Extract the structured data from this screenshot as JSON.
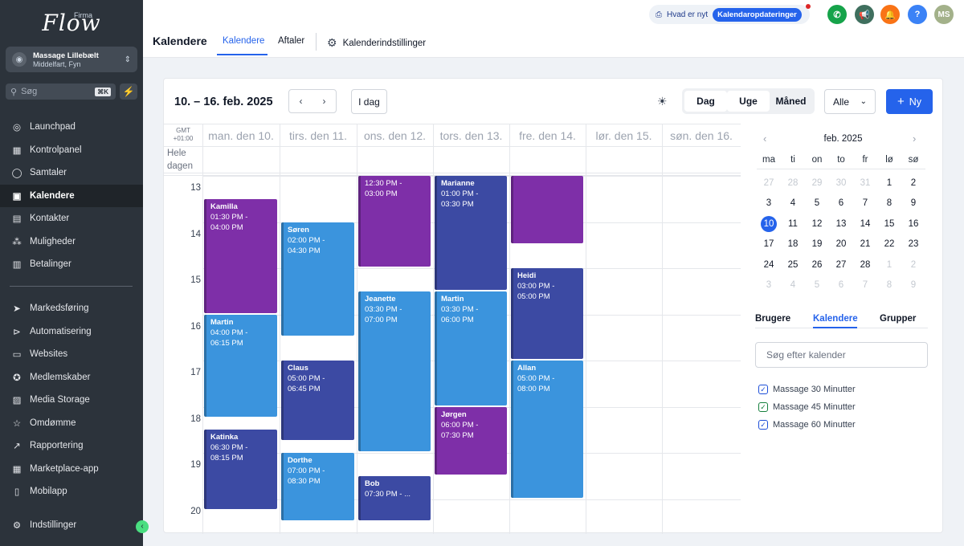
{
  "sidebar": {
    "logo_text": "Flow",
    "logo_super": "Firma",
    "account": {
      "name": "Massage Lillebælt",
      "location": "Middelfart, Fyn"
    },
    "search": {
      "placeholder": "Søg",
      "shortcut": "⌘K"
    },
    "items": [
      {
        "label": "Launchpad",
        "icon": "launchpad-icon"
      },
      {
        "label": "Kontrolpanel",
        "icon": "dashboard-icon"
      },
      {
        "label": "Samtaler",
        "icon": "chat-icon"
      },
      {
        "label": "Kalendere",
        "icon": "calendar-icon",
        "active": true
      },
      {
        "label": "Kontakter",
        "icon": "contacts-icon"
      },
      {
        "label": "Muligheder",
        "icon": "opportunities-icon"
      },
      {
        "label": "Betalinger",
        "icon": "payments-icon"
      }
    ],
    "items2": [
      {
        "label": "Markedsføring",
        "icon": "send-icon"
      },
      {
        "label": "Automatisering",
        "icon": "automation-icon"
      },
      {
        "label": "Websites",
        "icon": "websites-icon"
      },
      {
        "label": "Medlemskaber",
        "icon": "membership-icon"
      },
      {
        "label": "Media Storage",
        "icon": "image-icon"
      },
      {
        "label": "Omdømme",
        "icon": "star-icon"
      },
      {
        "label": "Rapportering",
        "icon": "chart-icon"
      },
      {
        "label": "Marketplace-app",
        "icon": "apps-icon"
      },
      {
        "label": "Mobilapp",
        "icon": "mobile-icon"
      }
    ],
    "settings": "Indstillinger"
  },
  "topbar": {
    "whats_new": "Hvad er nyt",
    "whats_new_tag": "Kalendaropdateringer",
    "avatar_initials": "MS",
    "help": "?",
    "page_title": "Kalendere",
    "tabs": [
      "Kalendere",
      "Aftaler"
    ],
    "settings_link": "Kalenderindstillinger"
  },
  "toolbar": {
    "range": "10. – 16. feb. 2025",
    "today": "I dag",
    "views": [
      "Dag",
      "Uge",
      "Måned"
    ],
    "filter": "Alle",
    "new": "Ny"
  },
  "week": {
    "gmt": [
      "GMT",
      "+01:00"
    ],
    "allday": [
      "Hele",
      "dagen"
    ],
    "days": [
      "man. den 10.",
      "tirs. den 11.",
      "ons. den 12.",
      "tors. den 13.",
      "fre. den 14.",
      "lør. den 15.",
      "søn. den 16."
    ],
    "hours": [
      "13",
      "14",
      "15",
      "16",
      "17",
      "18",
      "19",
      "20"
    ]
  },
  "events": [
    {
      "day": 0,
      "name": "Kamilla",
      "time": "01:30 PM -",
      "time2": "04:00 PM",
      "start": 13.5,
      "end": 16.0,
      "color": "#7e2fa8"
    },
    {
      "day": 0,
      "name": "Martin",
      "time": "04:00 PM -",
      "time2": "06:15 PM",
      "start": 16.0,
      "end": 18.25,
      "color": "#3b94dd"
    },
    {
      "day": 0,
      "name": "Katinka",
      "time": "06:30 PM -",
      "time2": "08:15 PM",
      "start": 18.5,
      "end": 20.25,
      "color": "#3c4aa3"
    },
    {
      "day": 1,
      "name": "Søren",
      "time": "02:00 PM -",
      "time2": "04:30 PM",
      "start": 14.0,
      "end": 16.5,
      "color": "#3b94dd"
    },
    {
      "day": 1,
      "name": "Claus",
      "time": "05:00 PM -",
      "time2": "06:45 PM",
      "start": 17.0,
      "end": 18.75,
      "color": "#3c4aa3"
    },
    {
      "day": 1,
      "name": "Dorthe",
      "time": "07:00 PM -",
      "time2": "08:30 PM",
      "start": 19.0,
      "end": 20.5,
      "color": "#3b94dd"
    },
    {
      "day": 2,
      "name": "",
      "time": "12:30 PM -",
      "time2": "03:00 PM",
      "start": 12.5,
      "end": 15.0,
      "color": "#7e2fa8"
    },
    {
      "day": 2,
      "name": "Jeanette",
      "time": "03:30 PM -",
      "time2": "07:00 PM",
      "start": 15.5,
      "end": 19.0,
      "color": "#3b94dd"
    },
    {
      "day": 2,
      "name": "Bob",
      "time": "07:30 PM - ...",
      "time2": "",
      "start": 19.5,
      "end": 20.5,
      "color": "#3c4aa3"
    },
    {
      "day": 3,
      "name": "Marianne",
      "time": "01:00 PM -",
      "time2": "03:30 PM",
      "start": 13.0,
      "end": 15.5,
      "color": "#3c4aa3"
    },
    {
      "day": 3,
      "name": "Martin",
      "time": "03:30 PM -",
      "time2": "06:00 PM",
      "start": 15.5,
      "end": 18.0,
      "color": "#3b94dd"
    },
    {
      "day": 3,
      "name": "Jørgen",
      "time": "06:00 PM -",
      "time2": "07:30 PM",
      "start": 18.0,
      "end": 19.5,
      "color": "#7e2fa8"
    },
    {
      "day": 4,
      "name": "",
      "time": "",
      "time2": "",
      "start": 12.5,
      "end": 14.5,
      "color": "#7e2fa8"
    },
    {
      "day": 4,
      "name": "Heidi",
      "time": "03:00 PM -",
      "time2": "05:00 PM",
      "start": 15.0,
      "end": 17.0,
      "color": "#3c4aa3"
    },
    {
      "day": 4,
      "name": "Allan",
      "time": "05:00 PM -",
      "time2": "08:00 PM",
      "start": 17.0,
      "end": 20.0,
      "color": "#3b94dd"
    }
  ],
  "mini_calendar": {
    "month": "feb. 2025",
    "weekdays": [
      "ma",
      "ti",
      "on",
      "to",
      "fr",
      "lø",
      "sø"
    ],
    "weeks": [
      [
        "27",
        "28",
        "29",
        "30",
        "31",
        "1",
        "2"
      ],
      [
        "3",
        "4",
        "5",
        "6",
        "7",
        "8",
        "9"
      ],
      [
        "10",
        "11",
        "12",
        "13",
        "14",
        "15",
        "16"
      ],
      [
        "17",
        "18",
        "19",
        "20",
        "21",
        "22",
        "23"
      ],
      [
        "24",
        "25",
        "26",
        "27",
        "28",
        "1",
        "2"
      ],
      [
        "3",
        "4",
        "5",
        "6",
        "7",
        "8",
        "9"
      ]
    ],
    "selected": "10"
  },
  "panel": {
    "tabs": [
      "Brugere",
      "Kalendere",
      "Grupper"
    ],
    "search_placeholder": "Søg efter kalender",
    "calendars": [
      "Massage 30 Minutter",
      "Massage 45 Minutter",
      "Massage 60 Minutter"
    ]
  },
  "colors": {
    "accent": "#2563eb",
    "purple": "#7e2fa8",
    "blue": "#3b94dd",
    "indigo": "#3c4aa3"
  }
}
